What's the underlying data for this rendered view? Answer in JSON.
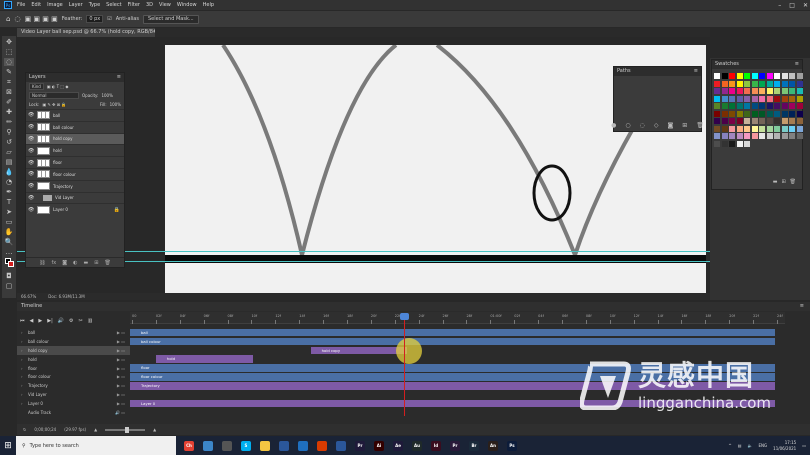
{
  "menu": {
    "items": [
      "File",
      "Edit",
      "Image",
      "Layer",
      "Type",
      "Select",
      "Filter",
      "3D",
      "View",
      "Window",
      "Help"
    ]
  },
  "options_bar": {
    "feather_label": "Feather:",
    "feather_value": "0 px",
    "anti_alias_label": "Anti-alias",
    "select_mask_label": "Select and Mask..."
  },
  "document": {
    "tab_title": "Video Layer ball sep.psd @ 66.7% (hold copy, RGB/8#) *",
    "zoom": "66.67%",
    "doc_info": "Doc: 6.93M/11.3M"
  },
  "layers_panel": {
    "title": "Layers",
    "kind_filter": "Kind",
    "blend_mode": "Normal",
    "opacity_label": "Opacity:",
    "opacity_value": "100%",
    "lock_label": "Lock:",
    "fill_label": "Fill:",
    "fill_value": "100%",
    "layers": [
      {
        "name": "ball",
        "type": "video",
        "active": false
      },
      {
        "name": "ball colour",
        "type": "video",
        "active": false
      },
      {
        "name": "hold copy",
        "type": "video",
        "active": true
      },
      {
        "name": "hold",
        "type": "image",
        "active": false
      },
      {
        "name": "floor",
        "type": "video",
        "active": false
      },
      {
        "name": "floor colour",
        "type": "video",
        "active": false
      },
      {
        "name": "Trajectory",
        "type": "image",
        "active": false
      },
      {
        "name": "Vid Layer",
        "type": "folder",
        "active": false
      },
      {
        "name": "Layer 0",
        "type": "image",
        "active": false,
        "locked": true
      }
    ]
  },
  "paths_panel": {
    "title": "Paths"
  },
  "swatches_panel": {
    "title": "Swatches",
    "colors": [
      "#ffffff",
      "#000000",
      "#ff0000",
      "#ffff00",
      "#00ff00",
      "#00ffff",
      "#0000ff",
      "#ff00ff",
      "#ffffff",
      "#e0e0e0",
      "#c0c0c0",
      "#a0a0a0",
      "#ed1c24",
      "#f26522",
      "#f7941d",
      "#fff200",
      "#8dc63f",
      "#39b54a",
      "#00a651",
      "#00a99d",
      "#00aeef",
      "#0072bc",
      "#0054a6",
      "#2e3192",
      "#662d91",
      "#92278f",
      "#ec008c",
      "#ed145b",
      "#f26c4f",
      "#f68e56",
      "#fbaf5d",
      "#fff568",
      "#acd373",
      "#7cc576",
      "#3bb878",
      "#1abbb4",
      "#00bff3",
      "#438ccb",
      "#5574b9",
      "#605ca8",
      "#8560a8",
      "#a864a8",
      "#f06eaa",
      "#f26d7d",
      "#9e0b0f",
      "#a0410d",
      "#a36209",
      "#aba000",
      "#598527",
      "#1a7b30",
      "#007236",
      "#00746b",
      "#0076a3",
      "#004b80",
      "#003471",
      "#1b1464",
      "#440e62",
      "#630460",
      "#9e005d",
      "#9e0039",
      "#790000",
      "#7b2e00",
      "#7d4900",
      "#827b00",
      "#406618",
      "#005e20",
      "#005826",
      "#005952",
      "#005b7f",
      "#003663",
      "#002157",
      "#0d004c",
      "#32004b",
      "#4b0049",
      "#7b0046",
      "#7a0026",
      "#c7b299",
      "#998675",
      "#736357",
      "#534741",
      "#37302d",
      "#c69c6d",
      "#a67c52",
      "#8c6239",
      "#754c24",
      "#603913",
      "#f5989d",
      "#f9ad81",
      "#fdc68a",
      "#fff799",
      "#c4df9b",
      "#a3d39c",
      "#82ca9c",
      "#7accc8",
      "#6dcff6",
      "#7da7d9",
      "#8393ca",
      "#8781bd",
      "#a186be",
      "#bd8cbf",
      "#f49ac1",
      "#f5989d",
      "#e6e6e6",
      "#cccccc",
      "#b3b3b3",
      "#999999",
      "#808080",
      "#666666",
      "#4d4d4d",
      "#333333",
      "#1a1a1a",
      "#f2f2f2",
      "#d9d9d9"
    ]
  },
  "timeline": {
    "title": "Timeline",
    "timecode": "0;00;00;24",
    "fps": "(29.97 fps)",
    "ruler_labels": [
      "00",
      "02f",
      "04f",
      "06f",
      "08f",
      "10f",
      "12f",
      "14f",
      "16f",
      "18f",
      "20f",
      "22f",
      "24f",
      "26f",
      "28f",
      "01:00f",
      "02f",
      "04f",
      "06f",
      "08f",
      "10f",
      "12f",
      "14f",
      "16f",
      "18f",
      "20f",
      "22f",
      "24f"
    ],
    "tracks": [
      {
        "name": "ball"
      },
      {
        "name": "ball colour"
      },
      {
        "name": "hold copy",
        "active": true
      },
      {
        "name": "hold"
      },
      {
        "name": "floor"
      },
      {
        "name": "floor colour"
      },
      {
        "name": "Trajectory"
      },
      {
        "name": "Vid Layer"
      },
      {
        "name": "Layer 0"
      },
      {
        "name": "Audio Track"
      }
    ],
    "clips": [
      {
        "label": "ball",
        "row": 0,
        "start": 0.0,
        "end": 1.0,
        "color": "blue"
      },
      {
        "label": "ball colour",
        "row": 1,
        "start": 0.0,
        "end": 1.0,
        "color": "blue"
      },
      {
        "label": "hold copy",
        "row": 2,
        "start": 0.28,
        "end": 0.43,
        "color": "purple"
      },
      {
        "label": "hold",
        "row": 3,
        "start": 0.04,
        "end": 0.19,
        "color": "purple"
      },
      {
        "label": "floor",
        "row": 4,
        "start": 0.0,
        "end": 1.0,
        "color": "blue"
      },
      {
        "label": "floor colour",
        "row": 5,
        "start": 0.0,
        "end": 1.0,
        "color": "blue"
      },
      {
        "label": "Trajectory",
        "row": 6,
        "start": 0.0,
        "end": 1.0,
        "color": "purple"
      },
      {
        "label": "Layer 0",
        "row": 8,
        "start": 0.0,
        "end": 1.0,
        "color": "purple"
      }
    ]
  },
  "taskbar": {
    "search_placeholder": "Type here to search",
    "apps": [
      {
        "label": "Ch",
        "color": "#e34133"
      },
      {
        "label": "",
        "color": "#3c86c9"
      },
      {
        "label": "",
        "color": "#555555"
      },
      {
        "label": "S",
        "color": "#00aff0"
      },
      {
        "label": "",
        "color": "#f4c542"
      },
      {
        "label": "",
        "color": "#2b579a"
      },
      {
        "label": "",
        "color": "#1f6fbf"
      },
      {
        "label": "",
        "color": "#d83b01"
      },
      {
        "label": "",
        "color": "#2b579a"
      },
      {
        "label": "Pr",
        "color": "#1f1a3a"
      },
      {
        "label": "Ai",
        "color": "#330000"
      },
      {
        "label": "Ae",
        "color": "#1f1a3a"
      },
      {
        "label": "Au",
        "color": "#1f2a2a"
      },
      {
        "label": "Id",
        "color": "#3a0d1f"
      },
      {
        "label": "Pr",
        "color": "#2a1a3a"
      },
      {
        "label": "Br",
        "color": "#1a2a3a"
      },
      {
        "label": "An",
        "color": "#2a1f1a"
      },
      {
        "label": "Ps",
        "color": "#0c1c3a"
      }
    ],
    "lang": "ENG",
    "time": "17:15",
    "date": "11/06/2021"
  },
  "watermark": {
    "cn": "灵感中国",
    "en": "lingganchina.com"
  }
}
